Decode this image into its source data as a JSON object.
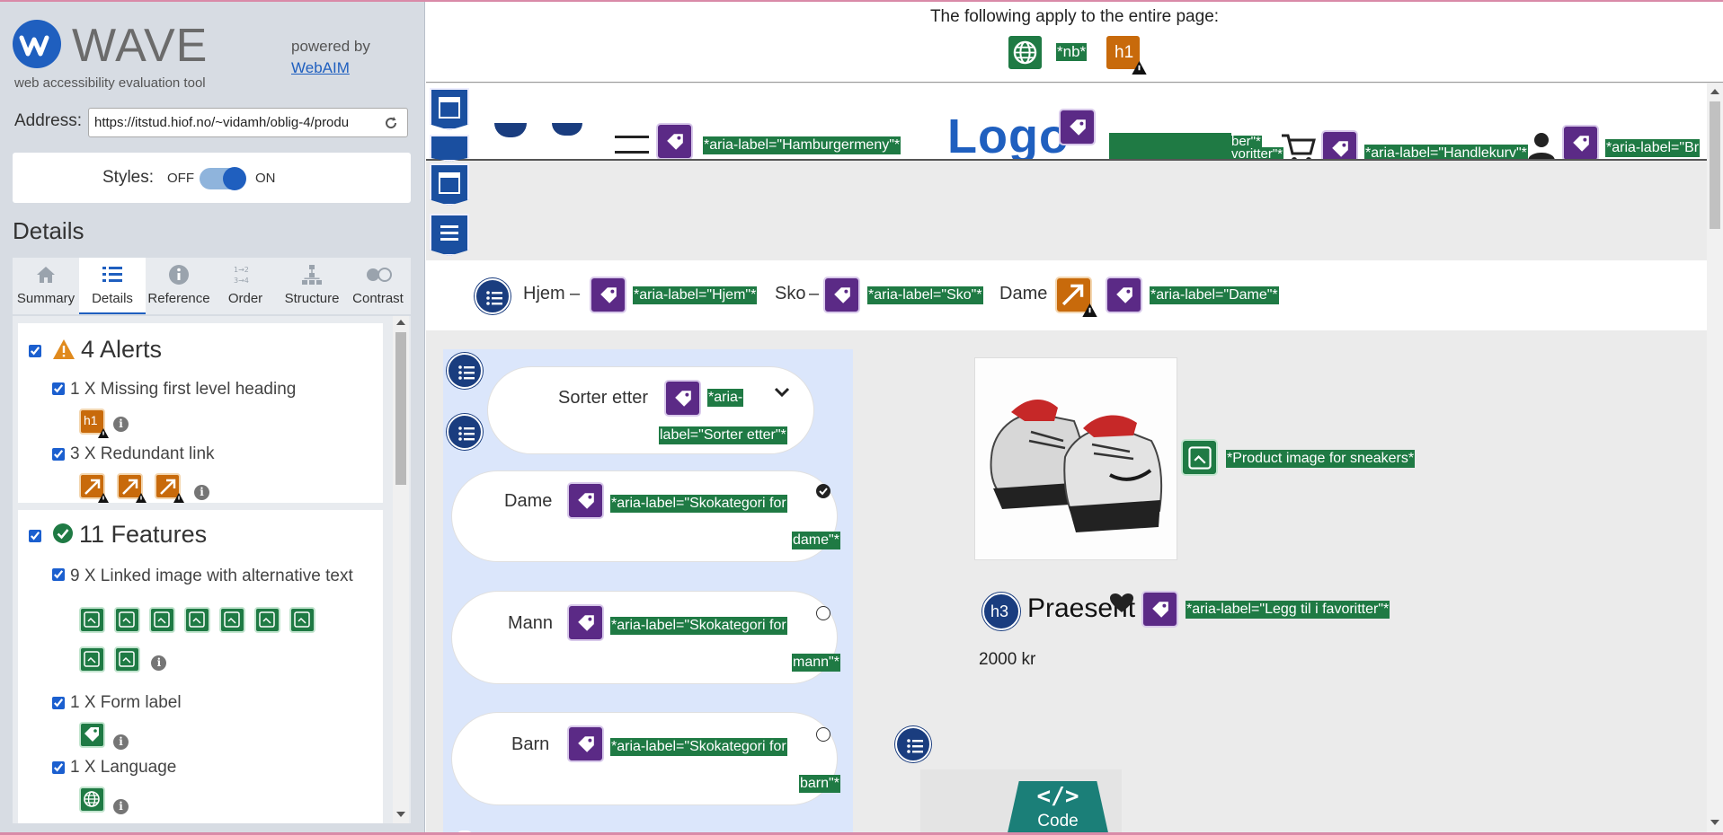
{
  "wave": {
    "title": "WAVE",
    "subtitle": "web accessibility evaluation tool",
    "powered_by": "powered by",
    "webaim_link": "WebAIM",
    "address_label": "Address:",
    "address_value": "https://itstud.hiof.no/~vidamh/oblig-4/produ",
    "styles_label": "Styles:",
    "styles_off": "OFF",
    "styles_on": "ON",
    "details_heading": "Details",
    "tabs": [
      {
        "label": "Summary",
        "icon": "home-icon"
      },
      {
        "label": "Details",
        "icon": "list-icon",
        "active": true
      },
      {
        "label": "Reference",
        "icon": "info-icon"
      },
      {
        "label": "Order",
        "icon": "order-icon"
      },
      {
        "label": "Structure",
        "icon": "structure-icon"
      },
      {
        "label": "Contrast",
        "icon": "contrast-icon"
      }
    ],
    "alerts": {
      "title": "4 Alerts",
      "items": [
        {
          "label": "1 X Missing first level heading"
        },
        {
          "label": "3 X Redundant link"
        }
      ]
    },
    "features": {
      "title": "11 Features",
      "items": [
        {
          "label": "9 X Linked image with alternative text"
        },
        {
          "label": "1 X Form label"
        },
        {
          "label": "1 X Language"
        }
      ]
    }
  },
  "page": {
    "applies_text": "The following apply to the entire page:",
    "lang_badge": "*nb*",
    "h1_badge": "h1",
    "header_labels": {
      "hamburger": "*aria-label=\"Hamburgermeny\"*",
      "logo": "Logo",
      "favoritter": "voritter\"*",
      "favoritter_top": "ber\"*",
      "handlekurv": "*aria-label=\"Handlekurv\"*",
      "bruker": "*aria-label=\"Br"
    },
    "breadcrumb": {
      "hjem": "Hjem",
      "sep": "–",
      "hjem_label": "*aria-label=\"Hjem\"*",
      "sko": "Sko",
      "sko_label": "*aria-label=\"Sko\"*",
      "dame": "Dame",
      "dame_label": "*aria-label=\"Dame\"*"
    },
    "sort": {
      "label": "Sorter etter",
      "aria_a": "*aria-",
      "aria_b": "label=\"Sorter etter\"*"
    },
    "categories": [
      {
        "name": "Dame",
        "aria_a": "*aria-label=\"Skokategori for",
        "aria_b": "dame\"*",
        "selected": true
      },
      {
        "name": "Mann",
        "aria_a": "*aria-label=\"Skokategori for",
        "aria_b": "mann\"*",
        "selected": false
      },
      {
        "name": "Barn",
        "aria_a": "*aria-label=\"Skokategori for",
        "aria_b": "barn\"*",
        "selected": false
      }
    ],
    "product": {
      "image_alt": "*Product image for sneakers*",
      "h3_badge": "h3",
      "name": "Praesent",
      "fav_label": "*aria-label=\"Legg til i favoritter\"*",
      "price": "2000 kr"
    },
    "code_button": "Code",
    "code_glyph": "</>"
  },
  "colors": {
    "feature_green": "#1f7a44",
    "alert_orange": "#c86a0b",
    "aria_purple": "#5b2a86",
    "structure_blue": "#1a4fa0"
  }
}
